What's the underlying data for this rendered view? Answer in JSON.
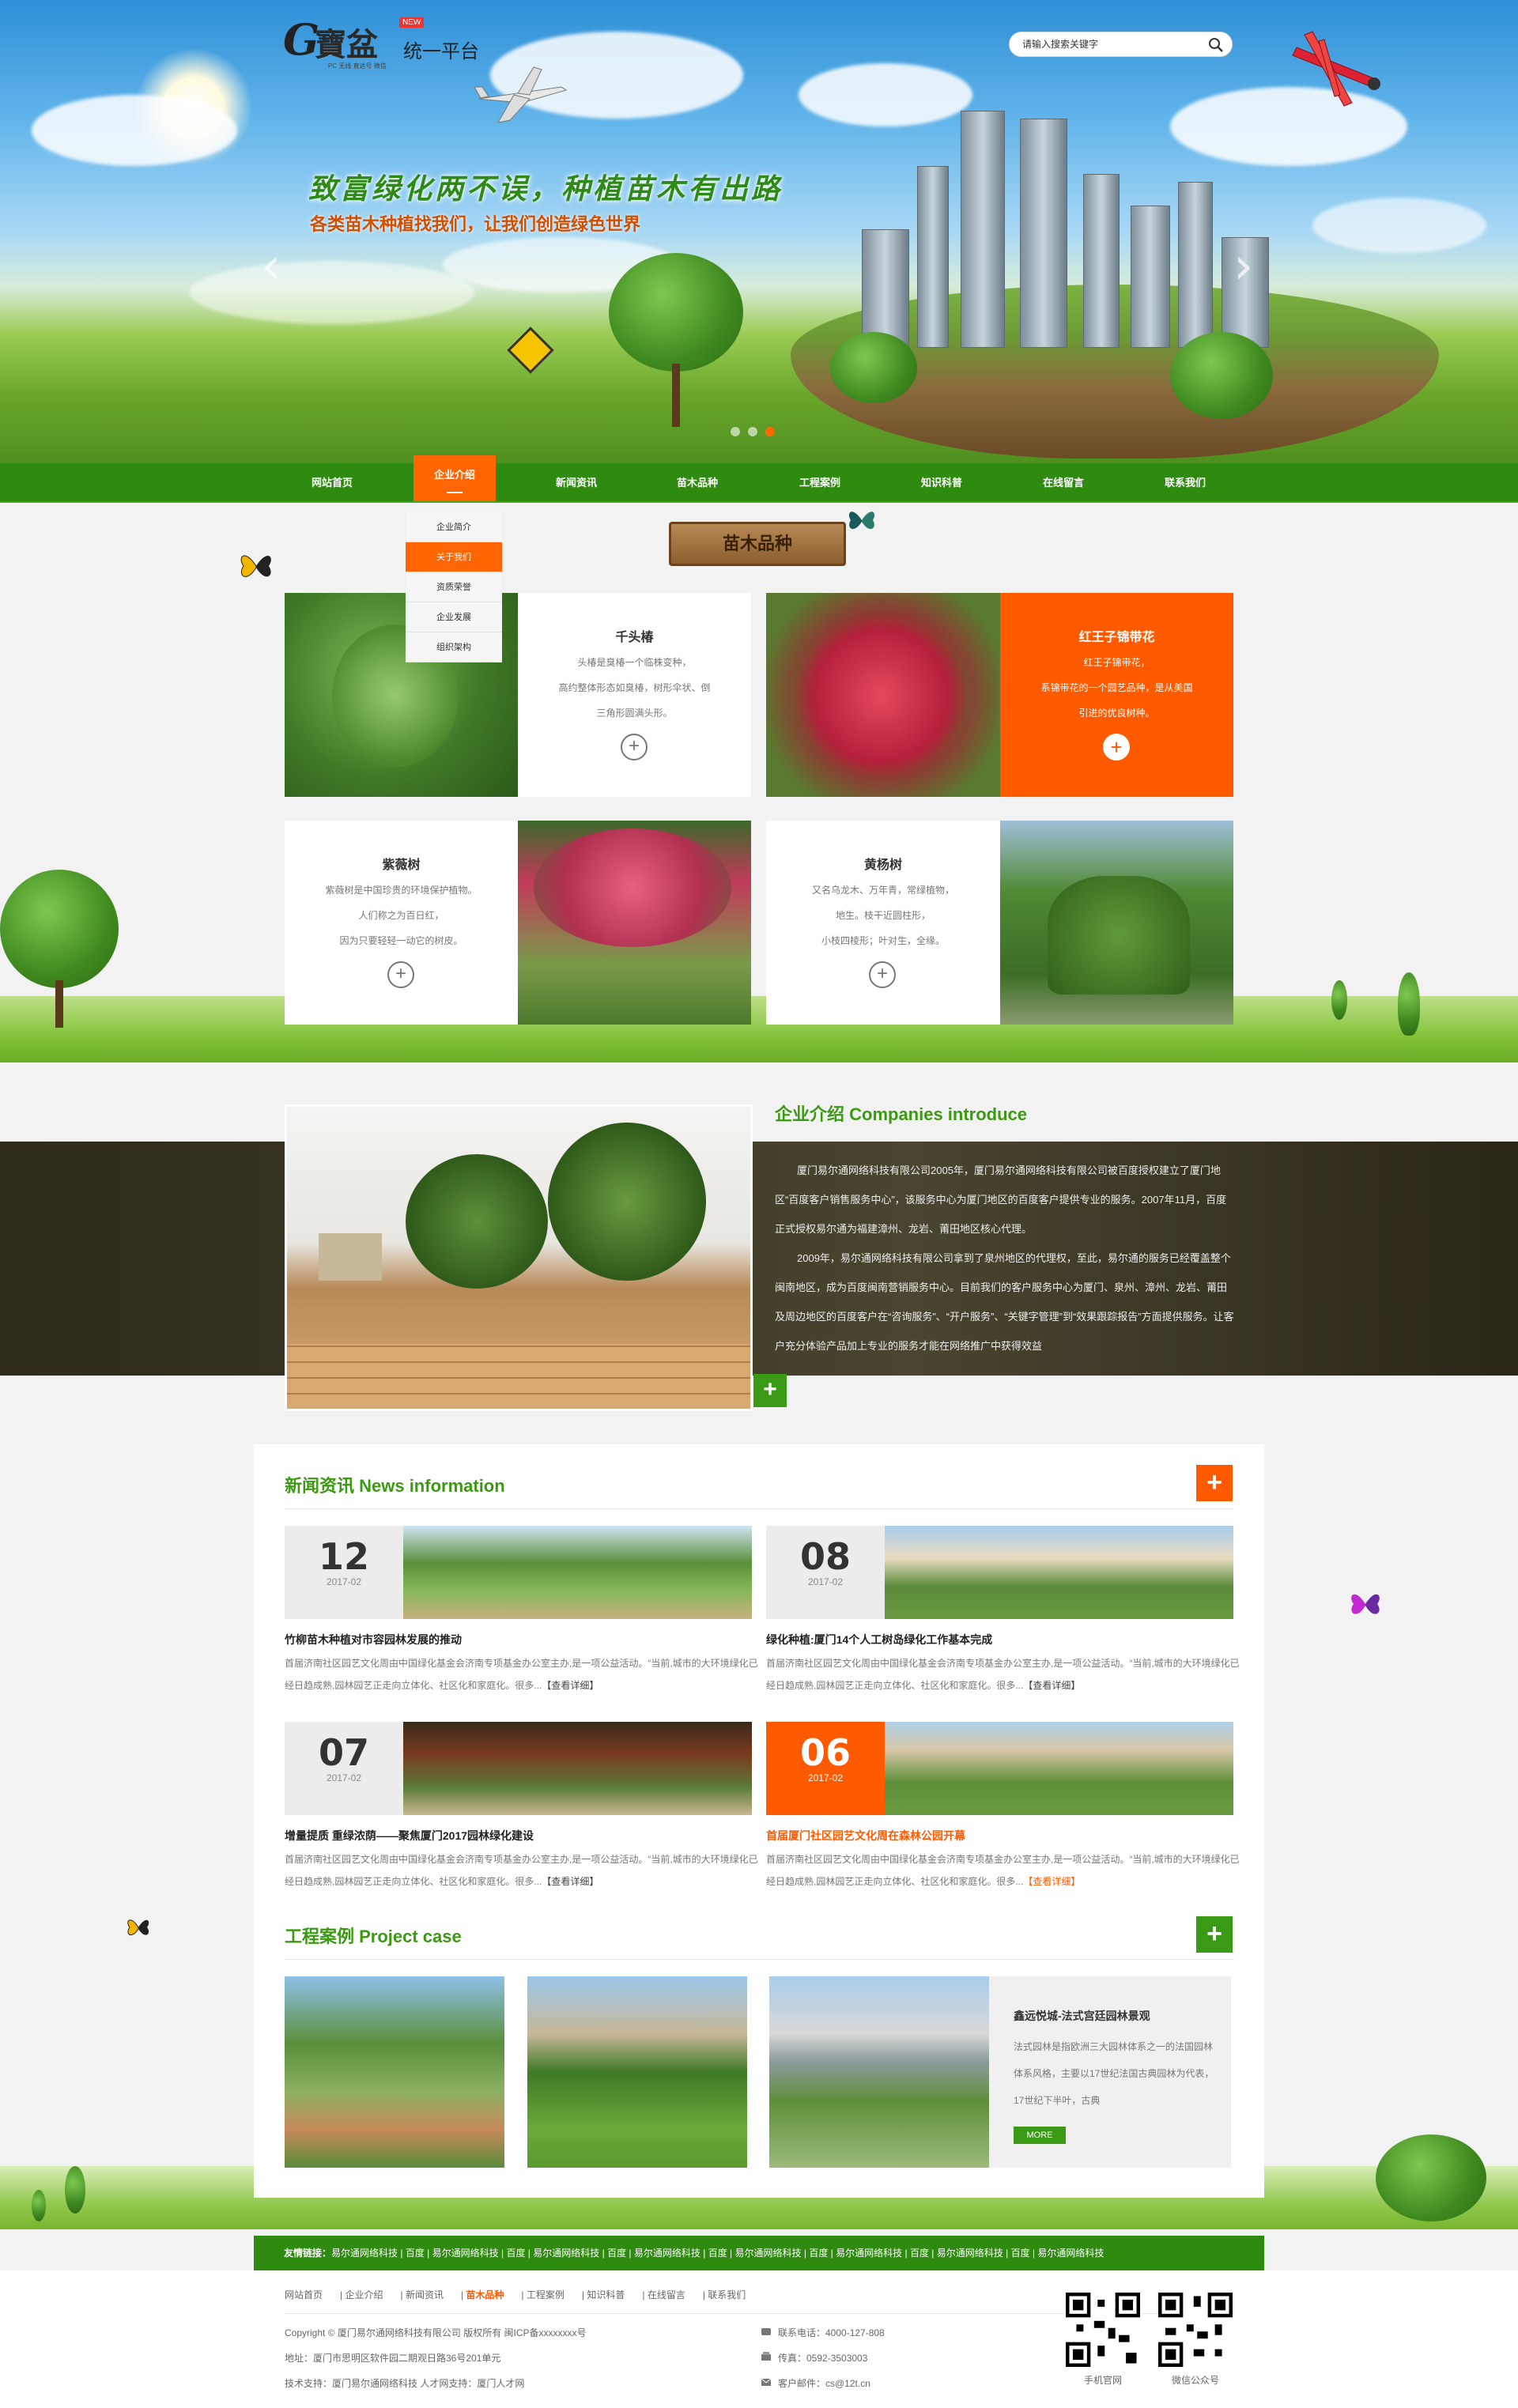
{
  "header": {
    "logo_mark": "G",
    "logo_name": "寶盆",
    "logo_badge": "NEW",
    "logo_platform": "统一平台",
    "logo_tagline": "PC 无线 直达号 微信",
    "search_placeholder": "请输入搜索关键字",
    "slogan": "致富绿化两不误，种植苗木有出路",
    "subslogan": "各类苗木种植找我们，让我们创造绿色世界",
    "prev_arrow": "‹",
    "next_arrow": "›"
  },
  "nav": {
    "items": [
      "网站首页",
      "企业介绍",
      "新闻资讯",
      "苗木品种",
      "工程案例",
      "知识科普",
      "在线留言",
      "联系我们"
    ],
    "active_index": 1,
    "dropdown": [
      "企业简介",
      "关于我们",
      "资质荣誉",
      "企业发展",
      "组织架构"
    ],
    "dropdown_active_index": 1
  },
  "species": {
    "section_title": "苗木品种",
    "cards": [
      {
        "title": "千头椿",
        "lines": [
          "头椿是臭椿一个临株变种，",
          "高约整体形态如臭椿，树形伞状、倒",
          "三角形圆满头形。"
        ],
        "plus": "+"
      },
      {
        "title": "红王子锦带花",
        "lines": [
          "红王子锦带花，",
          "系锦带花的一个园艺品种，是从美国",
          "引进的优良树种。"
        ],
        "plus": "+"
      },
      {
        "title": "紫薇树",
        "lines": [
          "紫薇树是中国珍贵的环境保护植物。",
          "人们称之为百日红，",
          "因为只要轻轻一动它的树皮。"
        ],
        "plus": "+"
      },
      {
        "title": "黄杨树",
        "lines": [
          "又名乌龙木、万年青，常绿植物，",
          "地生。枝干近圆柱形，",
          "小枝四棱形；叶对生，全缘。"
        ],
        "plus": "+"
      }
    ]
  },
  "intro": {
    "title": "企业介绍 Companies introduce",
    "paragraphs": [
      "厦门易尔通网络科技有限公司2005年，厦门易尔通网络科技有限公司被百度授权建立了厦门地区“百度客户销售服务中心”，该服务中心为厦门地区的百度客户提供专业的服务。2007年11月，百度正式授权易尔通为福建漳州、龙岩、莆田地区核心代理。",
      "2009年，易尔通网络科技有限公司拿到了泉州地区的代理权，至此，易尔通的服务已经覆盖整个闽南地区，成为百度闽南营销服务中心。目前我们的客户服务中心为厦门、泉州、漳州、龙岩、莆田及周边地区的百度客户在“咨询服务”、“开户服务”、“关键字管理”到“效果跟踪报告”方面提供服务。让客户充分体验产品加上专业的服务才能在网络推广中获得效益"
    ],
    "plus": "+"
  },
  "news": {
    "title": "新闻资讯 News information",
    "plus": "+",
    "items": [
      {
        "day": "12",
        "ym": "2017-02",
        "head": "竹柳苗木种植对市容园林发展的推动",
        "body": "首届济南社区园艺文化周由中国绿化基金会济南专项基金办公室主办,是一项公益活动。“当前,城市的大环境绿化已经日趋成熟,园林园艺正走向立体化、社区化和家庭化。很多...",
        "more": "【查看详细】",
        "highlight": false
      },
      {
        "day": "08",
        "ym": "2017-02",
        "head": "绿化种植:厦门14个人工树岛绿化工作基本完成",
        "body": "首届济南社区园艺文化周由中国绿化基金会济南专项基金办公室主办,是一项公益活动。“当前,城市的大环境绿化已经日趋成熟,园林园艺正走向立体化、社区化和家庭化。很多...",
        "more": "【查看详细】",
        "highlight": false
      },
      {
        "day": "07",
        "ym": "2017-02",
        "head": "增量提质 重绿浓荫——聚焦厦门2017园林绿化建设",
        "body": "首届济南社区园艺文化周由中国绿化基金会济南专项基金办公室主办,是一项公益活动。“当前,城市的大环境绿化已经日趋成熟,园林园艺正走向立体化、社区化和家庭化。很多...",
        "more": "【查看详细】",
        "highlight": false
      },
      {
        "day": "06",
        "ym": "2017-02",
        "head": "首届厦门社区园艺文化周在森林公园开幕",
        "body": "首届济南社区园艺文化周由中国绿化基金会济南专项基金办公室主办,是一项公益活动。“当前,城市的大环境绿化已经日趋成熟,园林园艺正走向立体化、社区化和家庭化。很多...",
        "more": "【查看详细】",
        "highlight": true
      }
    ]
  },
  "cases": {
    "title": "工程案例 Project case",
    "plus": "+",
    "featured_title": "鑫远悦城-法式宫廷园林景观",
    "featured_desc": "法式园林是指欧洲三大园林体系之一的法国园林体系风格，主要以17世纪法国古典园林为代表，17世纪下半叶，古典",
    "more": "MORE"
  },
  "footer": {
    "links_label": "友情链接：",
    "links": [
      "易尔通网络科技",
      "百度",
      "易尔通网络科技",
      "百度",
      "易尔通网络科技",
      "百度",
      "易尔通网络科技",
      "百度",
      "易尔通网络科技",
      "百度",
      "易尔通网络科技",
      "百度",
      "易尔通网络科技",
      "百度",
      "易尔通网络科技"
    ],
    "nav": [
      "网站首页",
      "企业介绍",
      "新闻资讯",
      "苗木品种",
      "工程案例",
      "知识科普",
      "在线留言",
      "联系我们"
    ],
    "nav_selected_index": 3,
    "copyright": "Copyright © 厦门易尔通网络科技有限公司 版权所有  闽ICP备xxxxxxxx号",
    "address": "地址：厦门市思明区软件园二期观日路36号201单元",
    "support": "技术支持：厦门易尔通网络科技  人才网支持：厦门人才网",
    "phone": "联系电话：4000-127-808",
    "fax": "传真：0592-3503003",
    "email": "客户邮件：cs@12t.cn",
    "qr1_label": "手机官网",
    "qr2_label": "微信公众号"
  },
  "colors": {
    "green": "#2f8a10",
    "orange": "#ff5a00",
    "title_green": "#3c9a12"
  }
}
